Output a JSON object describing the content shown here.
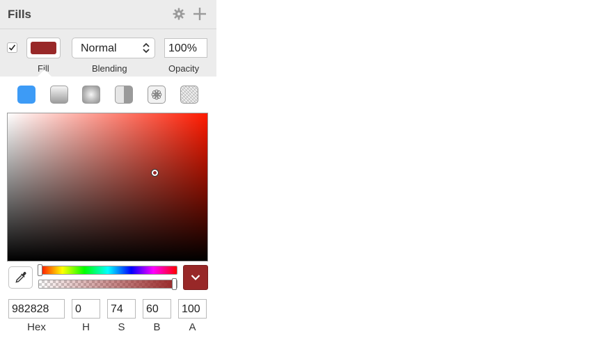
{
  "header": {
    "title": "Fills",
    "icons": [
      "gear-icon",
      "plus-icon"
    ]
  },
  "fill_row": {
    "enabled": true,
    "color": "#982828",
    "blending": "Normal",
    "opacity": "100%",
    "labels": {
      "fill": "Fill",
      "blending": "Blending",
      "opacity": "Opacity"
    }
  },
  "fill_types": [
    "solid-color",
    "linear-gradient",
    "radial-gradient",
    "angular-gradient",
    "pattern-fill",
    "noise-fill"
  ],
  "picker": {
    "accent": "#3d9bf6",
    "hex": "982828",
    "h": "0",
    "s": "74",
    "b": "60",
    "a": "100",
    "alpha_fraction": 1.0,
    "hue_fraction": 0.0,
    "labels": {
      "hex": "Hex",
      "h": "H",
      "s": "S",
      "b": "B",
      "a": "A"
    }
  }
}
